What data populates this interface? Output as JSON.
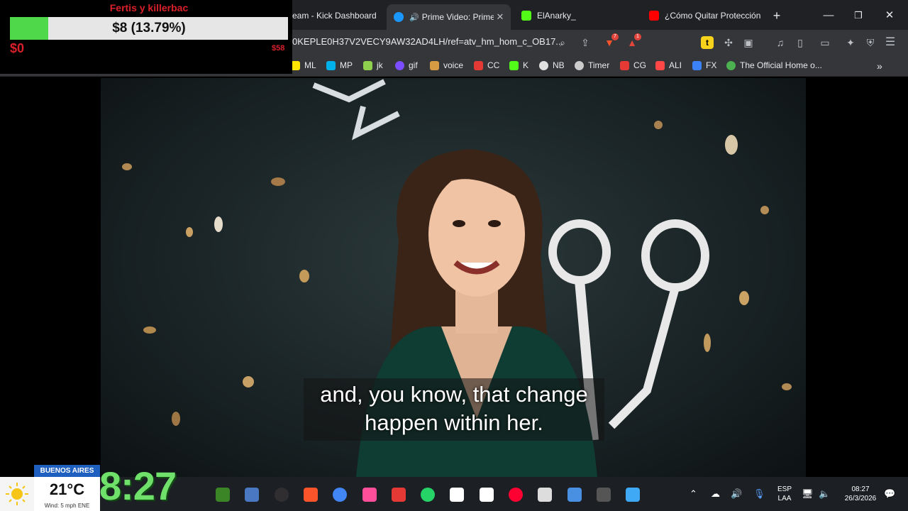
{
  "browser": {
    "tabs": [
      {
        "label": "eam - Kick Dashboard",
        "active": false,
        "icon": "kick-icon",
        "color": "#53fc18"
      },
      {
        "label": "Prime Video: Prime",
        "active": true,
        "icon": "prime-video-icon",
        "color": "#1a98ff"
      },
      {
        "label": "ElAnarky_",
        "active": false,
        "icon": "kick-icon",
        "color": "#53fc18"
      },
      {
        "label": "¿Cómo Quitar Protección",
        "active": false,
        "icon": "youtube-icon",
        "color": "#ff0000"
      }
    ],
    "new_tab_symbol": "+",
    "close_symbol": "✕",
    "url": "0KEPLE0H37V2VECY9AW32AD4LH/ref=atv_hm_hom_c_OB17...",
    "extension_badges": [
      "7",
      "1"
    ],
    "bookmarks": [
      {
        "label": "ML",
        "color": "#ffe600"
      },
      {
        "label": "MP",
        "color": "#00b1ea"
      },
      {
        "label": "jk",
        "color": "#8fd14f"
      },
      {
        "label": "gif",
        "color": "#7c4dff"
      },
      {
        "label": "voice",
        "color": "#d79b44"
      },
      {
        "label": "CC",
        "color": "#e53935"
      },
      {
        "label": "K",
        "color": "#53fc18"
      },
      {
        "label": "NB",
        "color": "#e0e0e0"
      },
      {
        "label": "Timer",
        "color": "#cccccc"
      },
      {
        "label": "CG",
        "color": "#e53935"
      },
      {
        "label": "ALI",
        "color": "#ff4747"
      },
      {
        "label": "FX",
        "color": "#3b82f6"
      },
      {
        "label": "The Official Home o...",
        "color": "#4caf50"
      }
    ],
    "bookmarks_more": "»"
  },
  "video": {
    "subtitle_line1": "and, you know, that change",
    "subtitle_line2": "happen within her."
  },
  "donation": {
    "title": "Fertis y killerbac",
    "amount_text": "$8 (13.79%)",
    "progress_percent": 13.79,
    "min_label": "$0",
    "max_label": "$58",
    "fill_color": "#4fd84a",
    "label_color": "#d9202a"
  },
  "weather": {
    "city": "BUENOS AIRES",
    "temperature": "21°C",
    "wind": "Wind: 5 mph ENE",
    "clock": "8:27"
  },
  "taskbar": {
    "language": "ESP",
    "layout": "LAA",
    "time": "08:27",
    "date": "26/3/2026",
    "apps": [
      {
        "name": "minecraft-icon",
        "color": "#3c8527"
      },
      {
        "name": "app-icon",
        "color": "#4a78c2"
      },
      {
        "name": "obs-icon",
        "color": "#302e31"
      },
      {
        "name": "brave-icon",
        "color": "#fb542b"
      },
      {
        "name": "chrome-icon",
        "color": "#4285f4"
      },
      {
        "name": "app-icon",
        "color": "#ff4f9a"
      },
      {
        "name": "app-icon",
        "color": "#e53935"
      },
      {
        "name": "whatsapp-icon",
        "color": "#25d366"
      },
      {
        "name": "capcut-icon",
        "color": "#ffffff"
      },
      {
        "name": "capcut-icon",
        "color": "#ffffff"
      },
      {
        "name": "youtube-music-icon",
        "color": "#ff0033"
      },
      {
        "name": "app-icon",
        "color": "#dddddd"
      },
      {
        "name": "app-icon",
        "color": "#4a90e2"
      },
      {
        "name": "app-icon",
        "color": "#555555"
      },
      {
        "name": "app-icon",
        "color": "#3fa9f5"
      }
    ]
  }
}
